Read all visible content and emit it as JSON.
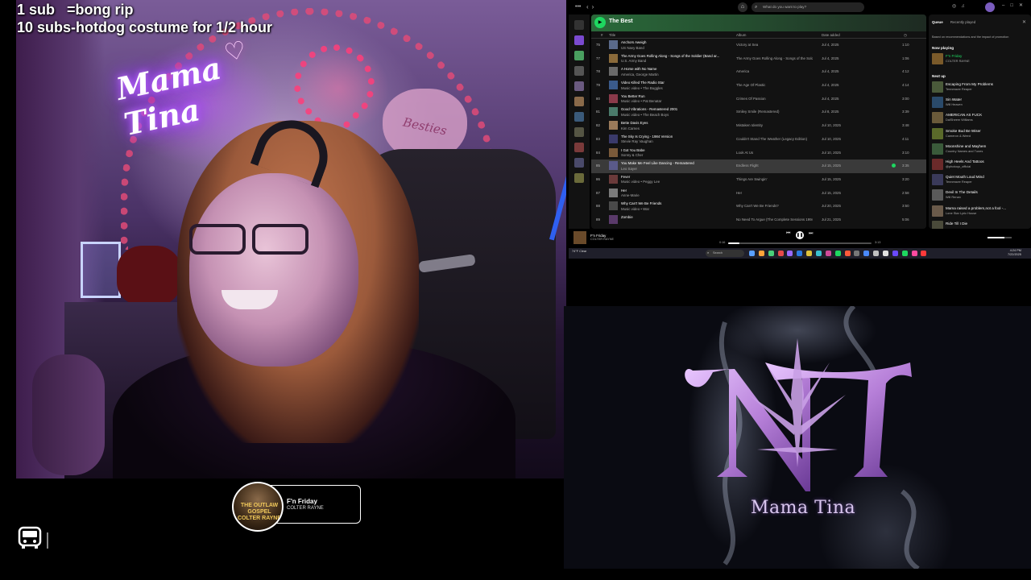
{
  "stream_overlay": {
    "line1": "1 sub   =bong rip",
    "line2": "10 subs-hotdog costume for 1/2 hour",
    "neon_sign": "Mama Tina",
    "heart_sign": "Besties",
    "now_playing": {
      "title": "F'n Friday",
      "artist": "COLTER RAYNE",
      "album_art_text": "THE OUTLAW GOSPEL COLTER RAYNE"
    }
  },
  "spotify": {
    "search_placeholder": "What do you want to play?",
    "playlist_title": "The Best",
    "columns": {
      "num": "#",
      "title": "Title",
      "album": "Album",
      "date": "Date added"
    },
    "rows": [
      {
        "num": "75",
        "title": "Anchors Aweigh",
        "artist": "US Navy Band",
        "album": "Victory at Sea",
        "date": "Jul 4, 2025",
        "duration": "1:10"
      },
      {
        "num": "77",
        "title": "The Army Goes Rolling Along - Songs of the Soldier (Band ar...",
        "artist": "U.S. Army Band",
        "album": "The Army Goes Rolling Along - Songs of the Soldier",
        "date": "Jul 4, 2025",
        "duration": "1:06"
      },
      {
        "num": "78",
        "title": "A Horse with No Name",
        "artist": "America, George Martin",
        "album": "America",
        "date": "Jul 4, 2025",
        "duration": "4:12"
      },
      {
        "num": "79",
        "title": "Video Killed The Radio Star",
        "artist": "Music video • The Buggles",
        "album": "The Age Of Plastic",
        "date": "Jul 4, 2025",
        "duration": "4:14"
      },
      {
        "num": "80",
        "title": "You Better Run",
        "artist": "Music video • Pat Benatar",
        "album": "Crimes Of Passion",
        "date": "Jul 4, 2025",
        "duration": "3:00"
      },
      {
        "num": "81",
        "title": "Good Vibrations - Remastered 2001",
        "artist": "Music video • The Beach Boys",
        "album": "Smiley Smile (Remastered)",
        "date": "Jul 8, 2025",
        "duration": "3:39"
      },
      {
        "num": "82",
        "title": "Bette Davis Eyes",
        "artist": "Kim Carnes",
        "album": "Mistaken Identity",
        "date": "Jul 10, 2025",
        "duration": "3:48"
      },
      {
        "num": "83",
        "title": "The Sky Is Crying - 1984 Version",
        "artist": "Stevie Ray Vaughan",
        "album": "Couldn't Stand The Weather (Legacy Edition)",
        "date": "Jul 10, 2025",
        "duration": "4:11"
      },
      {
        "num": "84",
        "title": "I Got You Babe",
        "artist": "Sonny & Cher",
        "album": "Look At Us",
        "date": "Jul 10, 2025",
        "duration": "3:10"
      },
      {
        "num": "85",
        "title": "You Make Me Feel Like Dancing - Remastered",
        "artist": "Leo Sayer",
        "album": "Endless Flight",
        "date": "Jul 15, 2025",
        "duration": "3:35",
        "selected": true
      },
      {
        "num": "86",
        "title": "Fever",
        "artist": "Music video • Peggy Lee",
        "album": "Things Are Swingin'",
        "date": "Jul 15, 2025",
        "duration": "3:20"
      },
      {
        "num": "87",
        "title": "Her",
        "artist": "Anne-Marie",
        "album": "Her",
        "date": "Jul 15, 2025",
        "duration": "2:58"
      },
      {
        "num": "88",
        "title": "Why Can't We Be Friends",
        "artist": "Music video • War",
        "album": "Why Can't We Be Friends?",
        "date": "Jul 20, 2025",
        "duration": "3:50"
      },
      {
        "num": "89",
        "title": "Zombie",
        "artist": "",
        "album": "No Need To Argue (The Complete Sessions 1994-1995)",
        "date": "Jul 21, 2025",
        "duration": "5:06"
      }
    ],
    "queue": {
      "tab_queue": "Queue",
      "tab_recent": "Recently played",
      "description": "Based on recommendations and the impact of promotion",
      "now_playing_label": "Now playing",
      "now_playing": {
        "title": "F'n Friday",
        "artist": "COLTER RAYNE"
      },
      "next_up_label": "Next up",
      "items": [
        {
          "title": "Escaping From My Problems",
          "artist": "Tennessee Reaper"
        },
        {
          "title": "Sin Water",
          "artist": "Will Heaven"
        },
        {
          "title": "AMERICAN AS FUCK",
          "artist": "DalSheem Williams"
        },
        {
          "title": "Smoke Bud Be Wiser",
          "artist": "Cameron & Weed"
        },
        {
          "title": "Moonshine and Mayhem",
          "artist": "Country Names and Tunes"
        },
        {
          "title": "High Heels And Tattoos",
          "artist": "@photoqo_official"
        },
        {
          "title": "Quiet Mouth Loud Mind",
          "artist": "Tennessee Reaper"
        },
        {
          "title": "Devil In The Details",
          "artist": "Will Renan"
        },
        {
          "title": "Mama raised a problem,not a fool -...",
          "artist": "Lone Star Lyric House"
        },
        {
          "title": "Ride Till I Die",
          "artist": ""
        }
      ]
    },
    "player": {
      "title": "F'n Friday",
      "artist": "COLTER RAYNE",
      "elapsed": "0:16",
      "total": "3:13",
      "progress": 0.08,
      "volume": 0.7
    }
  },
  "taskbar": {
    "weather": "74°F Clear",
    "search": "Search",
    "time": "4:24 PM",
    "date": "7/22/2025"
  },
  "logo": {
    "brand": "Mama Tina"
  },
  "colors": {
    "spotify_green": "#1ed760",
    "logo_purple": "#b67fd8"
  }
}
